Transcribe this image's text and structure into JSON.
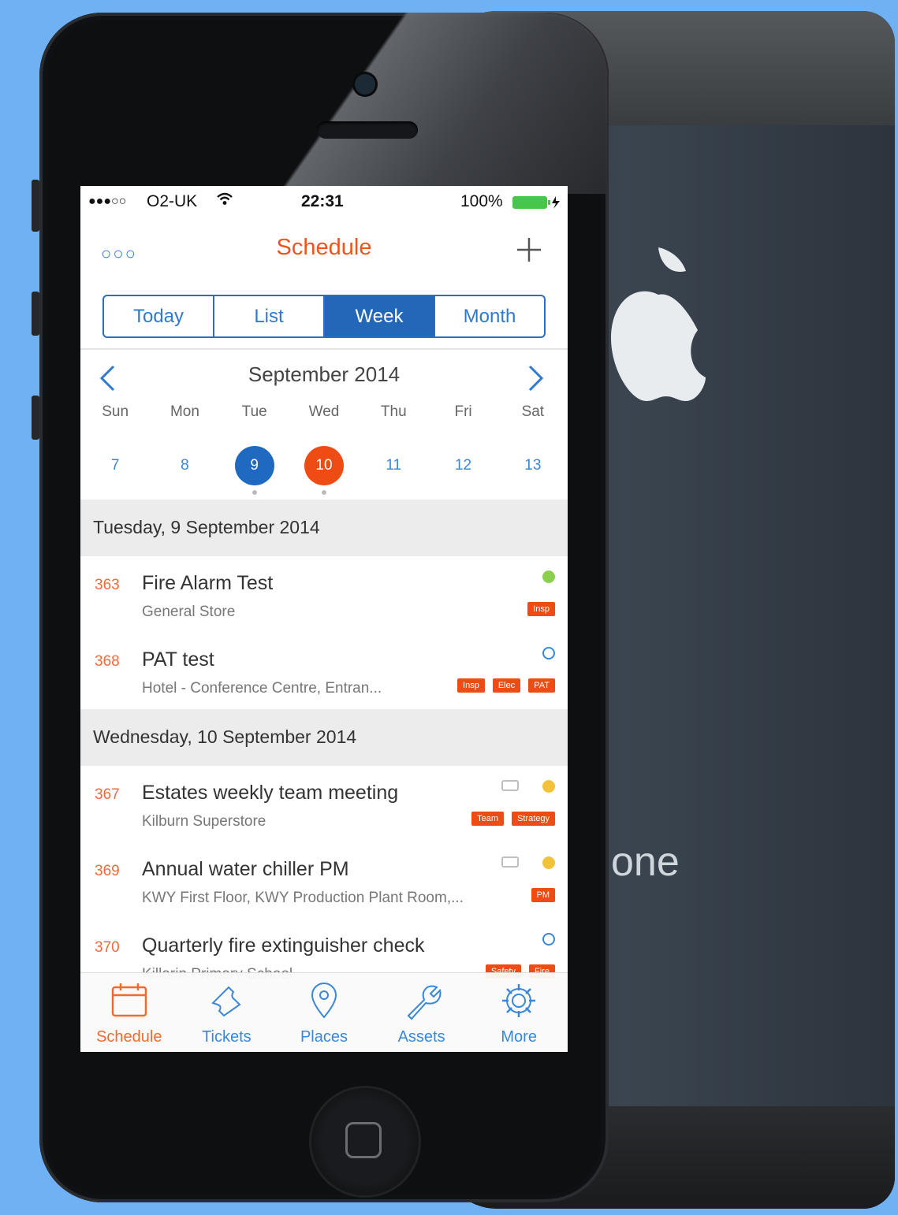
{
  "colors": {
    "accent": "#f0541e",
    "primary_blue": "#2368b8",
    "background": "#6fb1f2"
  },
  "back_phone": {
    "brand_partial": "one"
  },
  "status_bar": {
    "signal": "●●●○○",
    "carrier": "O2-UK",
    "wifi_icon": "wifi-icon",
    "time": "22:31",
    "battery": "100%"
  },
  "nav": {
    "title": "Schedule",
    "menu_icon": "more-dots-icon",
    "add_icon": "plus-icon"
  },
  "segments": [
    {
      "label": "Today",
      "active": false
    },
    {
      "label": "List",
      "active": false
    },
    {
      "label": "Week",
      "active": true
    },
    {
      "label": "Month",
      "active": false
    }
  ],
  "calendar": {
    "month_title": "September 2014",
    "weekdays": [
      "Sun",
      "Mon",
      "Tue",
      "Wed",
      "Thu",
      "Fri",
      "Sat"
    ],
    "dates": [
      {
        "day": "7",
        "state": "normal",
        "has_event": false
      },
      {
        "day": "8",
        "state": "normal",
        "has_event": false
      },
      {
        "day": "9",
        "state": "selected",
        "has_event": true
      },
      {
        "day": "10",
        "state": "today",
        "has_event": true
      },
      {
        "day": "11",
        "state": "normal",
        "has_event": false
      },
      {
        "day": "12",
        "state": "normal",
        "has_event": false
      },
      {
        "day": "13",
        "state": "normal",
        "has_event": false
      }
    ]
  },
  "sections": [
    {
      "header": "Tuesday, 9 September 2014",
      "items": [
        {
          "number": "363",
          "title": "Fire Alarm Test",
          "subtitle": "General Store",
          "status_color": "#8bcf4f",
          "repeat": false,
          "tags": [
            "Insp"
          ]
        },
        {
          "number": "368",
          "title": "PAT test",
          "subtitle": "Hotel - Conference Centre, Entran...",
          "status_color": "#ffffff",
          "repeat": false,
          "tags": [
            "Insp",
            "Elec",
            "PAT"
          ]
        }
      ]
    },
    {
      "header": "Wednesday, 10 September 2014",
      "items": [
        {
          "number": "367",
          "title": "Estates weekly team meeting",
          "subtitle": "Kilburn Superstore",
          "status_color": "#f2c23a",
          "repeat": true,
          "tags": [
            "Team",
            "Strategy"
          ]
        },
        {
          "number": "369",
          "title": "Annual water chiller PM",
          "subtitle": "KWY First Floor, KWY Production Plant Room,...",
          "status_color": "#f2c23a",
          "repeat": true,
          "tags": [
            "PM"
          ]
        },
        {
          "number": "370",
          "title": "Quarterly fire extinguisher check",
          "subtitle": "Killarin Primary School",
          "status_color": "#ffffff",
          "repeat": false,
          "tags": [
            "Safety",
            "Fire"
          ]
        }
      ]
    }
  ],
  "tabs": [
    {
      "label": "Schedule",
      "icon": "calendar-icon",
      "active": true
    },
    {
      "label": "Tickets",
      "icon": "ticket-icon",
      "active": false
    },
    {
      "label": "Places",
      "icon": "map-pin-icon",
      "active": false
    },
    {
      "label": "Assets",
      "icon": "wrench-icon",
      "active": false
    },
    {
      "label": "More",
      "icon": "gear-icon",
      "active": false
    }
  ]
}
